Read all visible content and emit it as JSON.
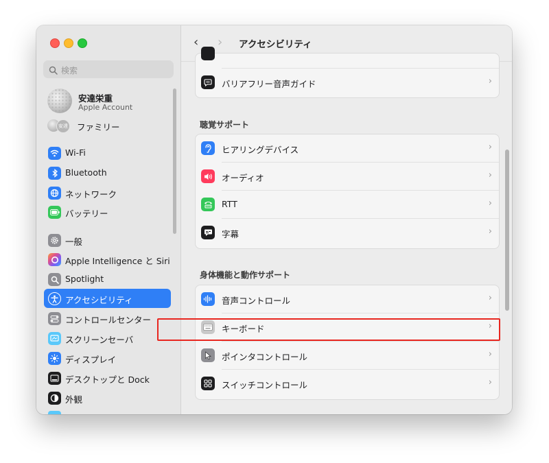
{
  "sidebar": {
    "search_placeholder": "検索",
    "account": {
      "name": "安達栄重",
      "subtitle": "Apple Account"
    },
    "family": {
      "avatar_text": "安達",
      "label": "ファミリー"
    },
    "items": [
      {
        "label": "Wi-Fi",
        "icon": "wifi-icon",
        "color": "#2f7ff6"
      },
      {
        "label": "Bluetooth",
        "icon": "bluetooth-icon",
        "color": "#2f7ff6"
      },
      {
        "label": "ネットワーク",
        "icon": "globe-icon",
        "color": "#2f7ff6"
      },
      {
        "label": "バッテリー",
        "icon": "battery-icon",
        "color": "#34c759"
      },
      {
        "label": "一般",
        "icon": "gear-icon",
        "color": "#8e8e93"
      },
      {
        "label": "Apple Intelligence と Siri",
        "icon": "siri-icon",
        "color": "#e0508c"
      },
      {
        "label": "Spotlight",
        "icon": "magnifier-icon",
        "color": "#8e8e93"
      },
      {
        "label": "アクセシビリティ",
        "icon": "accessibility-icon",
        "color": "#2f7ff6",
        "selected": true
      },
      {
        "label": "コントロールセンター",
        "icon": "control-center-icon",
        "color": "#8e8e93"
      },
      {
        "label": "スクリーンセーバ",
        "icon": "screensaver-icon",
        "color": "#5ac8fa"
      },
      {
        "label": "ディスプレイ",
        "icon": "sun-icon",
        "color": "#2f7ff6"
      },
      {
        "label": "デスクトップと Dock",
        "icon": "dock-icon",
        "color": "#1d1d1f"
      },
      {
        "label": "外観",
        "icon": "appearance-icon",
        "color": "#1d1d1f"
      }
    ]
  },
  "toolbar": {
    "back": "‹",
    "forward": "›",
    "title": "アクセシビリティ"
  },
  "main": {
    "group0": [
      {
        "label": "バリアフリー音声ガイド",
        "icon": "audio-description-icon",
        "color": "#1d1d1f"
      }
    ],
    "hearing": {
      "header": "聴覚サポート",
      "rows": [
        {
          "label": "ヒアリングデバイス",
          "icon": "ear-icon",
          "color": "#2f7ff6"
        },
        {
          "label": "オーディオ",
          "icon": "speaker-icon",
          "color": "#ff3b5c"
        },
        {
          "label": "RTT",
          "icon": "tty-icon",
          "color": "#34c759"
        },
        {
          "label": "字幕",
          "icon": "captions-icon",
          "color": "#1d1d1f"
        }
      ]
    },
    "motor": {
      "header": "身体機能と動作サポート",
      "rows": [
        {
          "label": "音声コントロール",
          "icon": "voice-control-icon",
          "color": "#2f7ff6"
        },
        {
          "label": "キーボード",
          "icon": "keyboard-icon",
          "color": "#c8c8c8"
        },
        {
          "label": "ポインタコントロール",
          "icon": "pointer-icon",
          "color": "#8e8e93"
        },
        {
          "label": "スイッチコントロール",
          "icon": "switch-control-icon",
          "color": "#1d1d1f"
        }
      ]
    },
    "chevron": "›"
  }
}
